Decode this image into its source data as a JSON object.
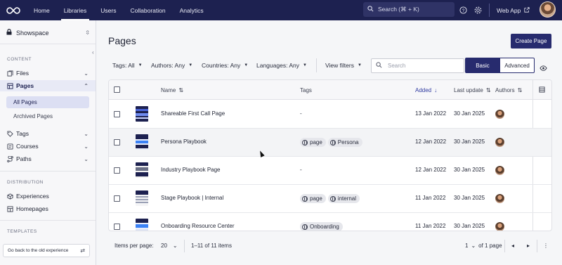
{
  "topnav": {
    "links": [
      "Home",
      "Libraries",
      "Users",
      "Collaboration",
      "Analytics"
    ],
    "active": "Libraries",
    "search_placeholder": "Search (⌘ + K)",
    "webapp_label": "Web App"
  },
  "sidebar": {
    "workspace": "Showspace",
    "content_title": "CONTENT",
    "items_content": [
      {
        "label": "Files",
        "icon": "files-icon"
      },
      {
        "label": "Pages",
        "icon": "pages-icon"
      }
    ],
    "subitems": [
      "All Pages",
      "Archived Pages"
    ],
    "items_more": [
      {
        "label": "Tags",
        "icon": "tag-icon"
      },
      {
        "label": "Courses",
        "icon": "course-icon"
      },
      {
        "label": "Paths",
        "icon": "path-icon"
      }
    ],
    "distribution_title": "DISTRIBUTION",
    "items_distribution": [
      {
        "label": "Experiences",
        "icon": "cube-icon"
      },
      {
        "label": "Homepages",
        "icon": "grid-icon"
      }
    ],
    "templates_title": "TEMPLATES",
    "old_experience": "Go back to the old experience"
  },
  "main": {
    "title": "Pages",
    "create_button": "Create Page",
    "filters": [
      "Tags: All",
      "Authors: Any",
      "Countries: Any",
      "Languages: Any"
    ],
    "view_filters": "View filters",
    "search_placeholder": "Search",
    "mode_basic": "Basic",
    "mode_advanced": "Advanced"
  },
  "table": {
    "headers": {
      "name": "Name",
      "tags": "Tags",
      "added": "Added",
      "last_update": "Last update",
      "authors": "Authors"
    },
    "rows": [
      {
        "name": "Shareable First Call Page",
        "tags": [],
        "tags_text": "-",
        "added": "13 Jan 2022",
        "updated": "30 Jan 2025"
      },
      {
        "name": "Persona Playbook",
        "tags": [
          "page",
          "Persona"
        ],
        "tags_text": "",
        "added": "12 Jan 2022",
        "updated": "30 Jan 2025"
      },
      {
        "name": "Industry Playbook Page",
        "tags": [],
        "tags_text": "-",
        "added": "12 Jan 2022",
        "updated": "30 Jan 2025"
      },
      {
        "name": "Stage Playbook | Internal",
        "tags": [
          "page",
          "internal"
        ],
        "tags_text": "",
        "added": "11 Jan 2022",
        "updated": "30 Jan 2025"
      },
      {
        "name": "Onboarding Resource Center",
        "tags": [
          "Onboarding"
        ],
        "tags_text": "",
        "added": "11 Jan 2022",
        "updated": "30 Jan 2025"
      }
    ]
  },
  "footer": {
    "items_per_page_label": "Items per page:",
    "items_per_page": "20",
    "range": "1–11 of 11 items",
    "current_page": "1",
    "of_pages": "of 1 page"
  },
  "colors": {
    "nav_bg": "#1d2150",
    "accent": "#272b6e",
    "sorted": "#2f3aa0"
  }
}
